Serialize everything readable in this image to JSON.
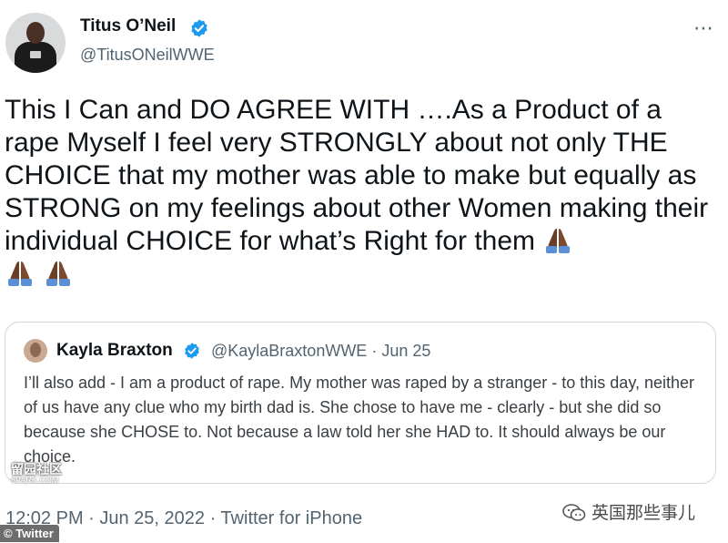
{
  "author": {
    "name": "Titus O’Neil",
    "handle": "@TitusONeilWWE"
  },
  "more_icon": "⋯",
  "tweet": {
    "text": "This I Can and DO AGREE WITH ….As a Product of a rape Myself I feel very STRONGLY about not only THE CHOICE that my mother was able to make but equally as STRONG on my feelings about other Women making their individual CHOICE for what’s Right for them"
  },
  "quoted": {
    "name": "Kayla Braxton",
    "meta": "@KaylaBraxtonWWE · Jun 25",
    "text": "I’ll also add - I am a product of rape. My mother was raped by a stranger - to this day, neither of us have any clue who my birth dad is. She chose to have me - clearly - but she did so because she CHOSE to. Not because a law told her she HAD to. It should always be our choice."
  },
  "footer": "12:02 PM · Jun 25, 2022 · Twitter for iPhone",
  "watermarks": {
    "left": "留园社区",
    "left_small": "6PARK.COM",
    "badge": "© Twitter",
    "wechat": "英国那些事儿"
  },
  "colors": {
    "verified": "#1d9bf0",
    "text": "#0f1419",
    "muted": "#536471",
    "border": "#cfd9de"
  },
  "icons": [
    "verified-badge-icon",
    "more-icon",
    "folded-hands-emoji",
    "wechat-icon"
  ]
}
